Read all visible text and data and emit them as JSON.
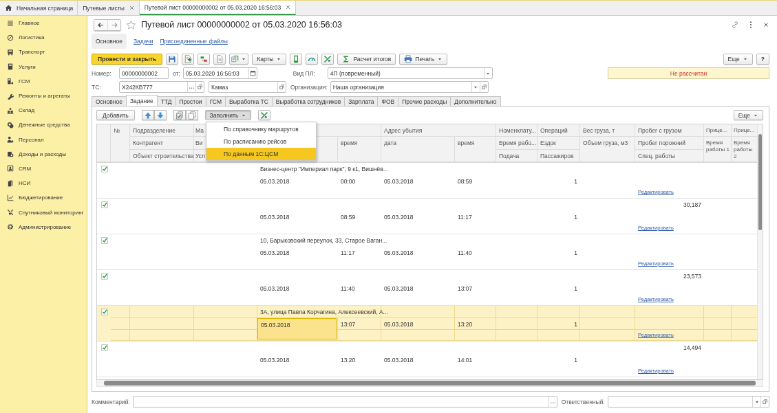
{
  "window_tabs": [
    {
      "label": "Начальная страница",
      "kind": "home",
      "selected": false
    },
    {
      "label": "Путевые листы",
      "kind": "closable",
      "selected": false
    },
    {
      "label": "Путевой лист 00000000002 от 05.03.2020 16:56:03",
      "kind": "closable",
      "selected": true
    }
  ],
  "sidebar": {
    "items": [
      {
        "label": "Главное"
      },
      {
        "label": "Логистика"
      },
      {
        "label": "Транспорт"
      },
      {
        "label": "Услуги"
      },
      {
        "label": "ГСМ"
      },
      {
        "label": "Ремонты и агрегаты"
      },
      {
        "label": "Склад"
      },
      {
        "label": "Денежные средства"
      },
      {
        "label": "Персонал"
      },
      {
        "label": "Доходы и расходы"
      },
      {
        "label": "CRM"
      },
      {
        "label": "НСИ"
      },
      {
        "label": "Бюджетирование"
      },
      {
        "label": "Спутниковый мониторинг"
      },
      {
        "label": "Администрирование"
      }
    ]
  },
  "document": {
    "title": "Путевой лист 00000000002 от 05.03.2020 16:56:03",
    "sections": [
      {
        "label": "Основное",
        "selected": true
      },
      {
        "label": "Задачи",
        "selected": false
      },
      {
        "label": "Присоединенные файлы",
        "selected": false
      }
    ],
    "toolbar": {
      "post_button": "Провести и закрыть",
      "maps_button": "Карты",
      "totals_button": "Расчет итогов",
      "print_button": "Печать",
      "more_button": "Еще",
      "help_button": "?"
    },
    "fields": {
      "number": {
        "label": "Номер:",
        "value": "00000000002"
      },
      "date": {
        "label": "от:",
        "value": "05.03.2020 16:56:03"
      },
      "waybill_type": {
        "label": "Вид ПЛ:",
        "value": "4П (повременный)"
      },
      "status": "Не рассчитан",
      "vehicle": {
        "label": "ТС:",
        "value": "Х242КВ777"
      },
      "vehicle_model": {
        "value": "Камаз"
      },
      "organization": {
        "label": "Организация:",
        "value": "Наша организация"
      }
    },
    "tabs": [
      {
        "label": "Основное",
        "selected": false
      },
      {
        "label": "Задание",
        "selected": true
      },
      {
        "label": "ТТД",
        "selected": false
      },
      {
        "label": "Простои",
        "selected": false
      },
      {
        "label": "ГСМ",
        "selected": false
      },
      {
        "label": "Выработка ТС",
        "selected": false
      },
      {
        "label": "Выработка сотрудников",
        "selected": false
      },
      {
        "label": "Зарплата",
        "selected": false
      },
      {
        "label": "ФОВ",
        "selected": false
      },
      {
        "label": "Прочие расходы",
        "selected": false
      },
      {
        "label": "Дополнительно",
        "selected": false
      }
    ],
    "task_toolbar": {
      "add_button": "Добавить",
      "fill_button": {
        "label": "Заполнить",
        "pressed": true
      },
      "more_button": "Еще"
    },
    "fill_menu": {
      "items": [
        {
          "label": "По справочнику маршрутов",
          "selected": false
        },
        {
          "label": "По расписанию рейсов",
          "selected": false
        },
        {
          "label": "По данным 1С:ЦСМ",
          "selected": true
        }
      ]
    },
    "table": {
      "columns": [
        {
          "kind": "full"
        },
        {
          "kind": "full",
          "row_1": "№"
        },
        {
          "kind": "split",
          "row_1": "Подразделение",
          "row_2": "Контрагент",
          "row_3": "Объект строительства"
        },
        {
          "kind": "split",
          "row_1": "Ма",
          "row_2": "Ви",
          "row_3": "Усл"
        },
        {
          "kind": "tall"
        },
        {
          "kind": "joined",
          "row_2": "время"
        },
        {
          "kind": "tall",
          "row_1": "Адрес убытия",
          "row_2": "дата"
        },
        {
          "kind": "joined",
          "row_2": "время"
        },
        {
          "kind": "split",
          "row_1": "Номенклату...",
          "row_2": "Время рабо...",
          "row_3": "Подача"
        },
        {
          "kind": "split",
          "row_1": "Операций",
          "row_2": "Ездок",
          "row_3": "Пассажиров"
        },
        {
          "kind": "tall",
          "row_1": "Вес груза, т",
          "row_2": "Объем груза, м3"
        },
        {
          "kind": "split",
          "row_1": "Пробег с грузом",
          "row_2": "Пробег порожний",
          "row_3": "Спец. работы"
        },
        {
          "kind": "tall",
          "row_1": "Прице...",
          "row_2": "Время работы 1"
        },
        {
          "kind": "tall",
          "row_1": "Прице...",
          "row_2": "Время работы 2"
        }
      ],
      "rows": [
        {
          "checked": true,
          "selected": false,
          "address": "Бизнес-центр \"Империал парк\", 9 к1, Вишнёв...",
          "date_from": "05.03.2018",
          "time_from": "00:00",
          "date_to": "05.03.2018",
          "time_to": "08:59",
          "trips": "1",
          "edit_link": "Редактировать"
        },
        {
          "checked": true,
          "selected": false,
          "date_from": "05.03.2018",
          "time_from": "08:59",
          "date_to": "05.03.2018",
          "time_to": "11:17",
          "trips": "1",
          "loaded_mileage": "30,187",
          "edit_link": "Редактировать"
        },
        {
          "checked": true,
          "selected": false,
          "address": "10, Барыковский переулок, 33, Старое Ваган...",
          "date_from": "05.03.2018",
          "time_from": "11:17",
          "date_to": "05.03.2018",
          "time_to": "11:40",
          "trips": "1",
          "edit_link": "Редактировать"
        },
        {
          "checked": true,
          "selected": false,
          "date_from": "05.03.2018",
          "time_from": "11:40",
          "date_to": "05.03.2018",
          "time_to": "13:07",
          "trips": "1",
          "loaded_mileage": "23,573",
          "edit_link": "Редактировать"
        },
        {
          "checked": true,
          "selected": true,
          "focused": true,
          "address": "3А, улица Павла Корчагина, Алексеевский, А...",
          "date_from": "05.03.2018",
          "time_from": "13:07",
          "date_to": "05.03.2018",
          "time_to": "13:20",
          "trips": "1",
          "edit_link": "Редактировать"
        },
        {
          "checked": true,
          "selected": false,
          "date_from": "05.03.2018",
          "time_from": "13:20",
          "date_to": "05.03.2018",
          "time_to": "14:01",
          "trips": "1",
          "loaded_mileage": "14,494",
          "edit_link": "Редактировать"
        }
      ]
    },
    "footer": {
      "comment": {
        "label": "Комментарий:"
      },
      "responsible": {
        "label": "Ответственный:"
      }
    }
  }
}
